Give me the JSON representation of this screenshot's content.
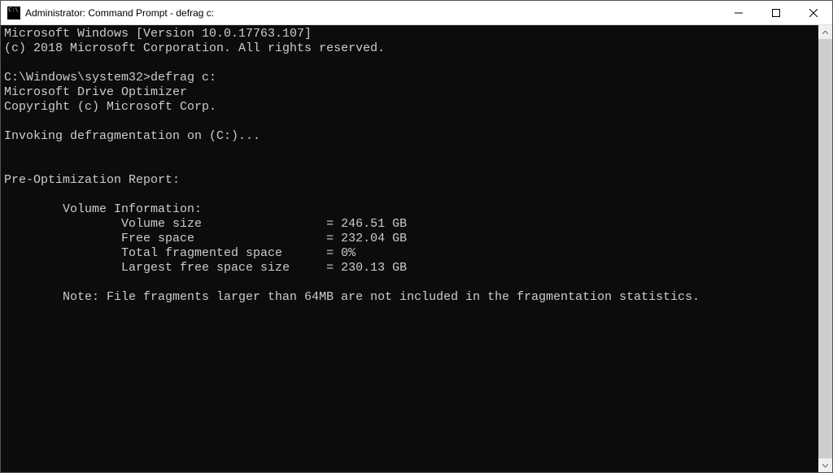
{
  "titlebar": {
    "title": "Administrator: Command Prompt - defrag  c:"
  },
  "lines": {
    "l0": "Microsoft Windows [Version 10.0.17763.107]",
    "l1": "(c) 2018 Microsoft Corporation. All rights reserved.",
    "blank": "",
    "prompt": "C:\\Windows\\system32>",
    "cmd": "defrag c:",
    "l3": "Microsoft Drive Optimizer",
    "l4": "Copyright (c) Microsoft Corp.",
    "l5": "Invoking defragmentation on (C:)...",
    "l6": "Pre-Optimization Report:",
    "l7": "\tVolume Information:",
    "r0label": "\t\tVolume size               ",
    "r0val": "  = 246.51 GB",
    "r1label": "\t\tFree space                ",
    "r1val": "  = 232.04 GB",
    "r2label": "\t\tTotal fragmented space    ",
    "r2val": "  = 0%",
    "r3label": "\t\tLargest free space size   ",
    "r3val": "  = 230.13 GB",
    "note": "\tNote: File fragments larger than 64MB are not included in the fragmentation statistics."
  }
}
